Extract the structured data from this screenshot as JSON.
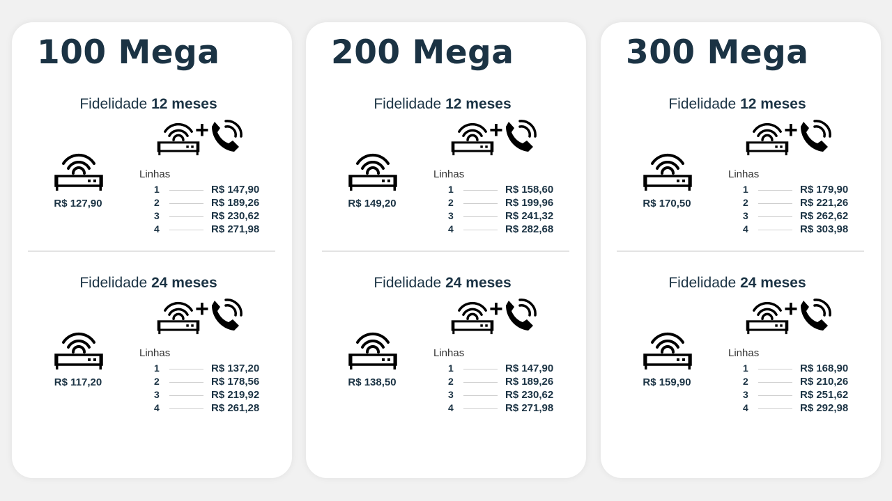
{
  "plans": [
    {
      "title": "100 Mega",
      "sections": [
        {
          "fid_prefix": "Fidelidade",
          "fid_term": "12 meses",
          "solo_price": "R$ 127,90",
          "lines_label": "Linhas",
          "lines": [
            {
              "num": "1",
              "price": "R$ 147,90"
            },
            {
              "num": "2",
              "price": "R$ 189,26"
            },
            {
              "num": "3",
              "price": "R$ 230,62"
            },
            {
              "num": "4",
              "price": "R$ 271,98"
            }
          ]
        },
        {
          "fid_prefix": "Fidelidade",
          "fid_term": "24 meses",
          "solo_price": "R$ 117,20",
          "lines_label": "Linhas",
          "lines": [
            {
              "num": "1",
              "price": "R$ 137,20"
            },
            {
              "num": "2",
              "price": "R$ 178,56"
            },
            {
              "num": "3",
              "price": "R$ 219,92"
            },
            {
              "num": "4",
              "price": "R$ 261,28"
            }
          ]
        }
      ]
    },
    {
      "title": "200 Mega",
      "sections": [
        {
          "fid_prefix": "Fidelidade",
          "fid_term": "12 meses",
          "solo_price": "R$ 149,20",
          "lines_label": "Linhas",
          "lines": [
            {
              "num": "1",
              "price": "R$ 158,60"
            },
            {
              "num": "2",
              "price": "R$ 199,96"
            },
            {
              "num": "3",
              "price": "R$ 241,32"
            },
            {
              "num": "4",
              "price": "R$ 282,68"
            }
          ]
        },
        {
          "fid_prefix": "Fidelidade",
          "fid_term": "24 meses",
          "solo_price": "R$ 138,50",
          "lines_label": "Linhas",
          "lines": [
            {
              "num": "1",
              "price": "R$ 147,90"
            },
            {
              "num": "2",
              "price": "R$ 189,26"
            },
            {
              "num": "3",
              "price": "R$ 230,62"
            },
            {
              "num": "4",
              "price": "R$ 271,98"
            }
          ]
        }
      ]
    },
    {
      "title": "300 Mega",
      "sections": [
        {
          "fid_prefix": "Fidelidade",
          "fid_term": "12 meses",
          "solo_price": "R$ 170,50",
          "lines_label": "Linhas",
          "lines": [
            {
              "num": "1",
              "price": "R$ 179,90"
            },
            {
              "num": "2",
              "price": "R$ 221,26"
            },
            {
              "num": "3",
              "price": "R$ 262,62"
            },
            {
              "num": "4",
              "price": "R$ 303,98"
            }
          ]
        },
        {
          "fid_prefix": "Fidelidade",
          "fid_term": "24 meses",
          "solo_price": "R$ 159,90",
          "lines_label": "Linhas",
          "lines": [
            {
              "num": "1",
              "price": "R$ 168,90"
            },
            {
              "num": "2",
              "price": "R$ 210,26"
            },
            {
              "num": "3",
              "price": "R$ 251,62"
            },
            {
              "num": "4",
              "price": "R$ 292,98"
            }
          ]
        }
      ]
    }
  ],
  "icons": {
    "router": "wifi-router-icon",
    "plus": "+",
    "phone": "phone-icon"
  }
}
